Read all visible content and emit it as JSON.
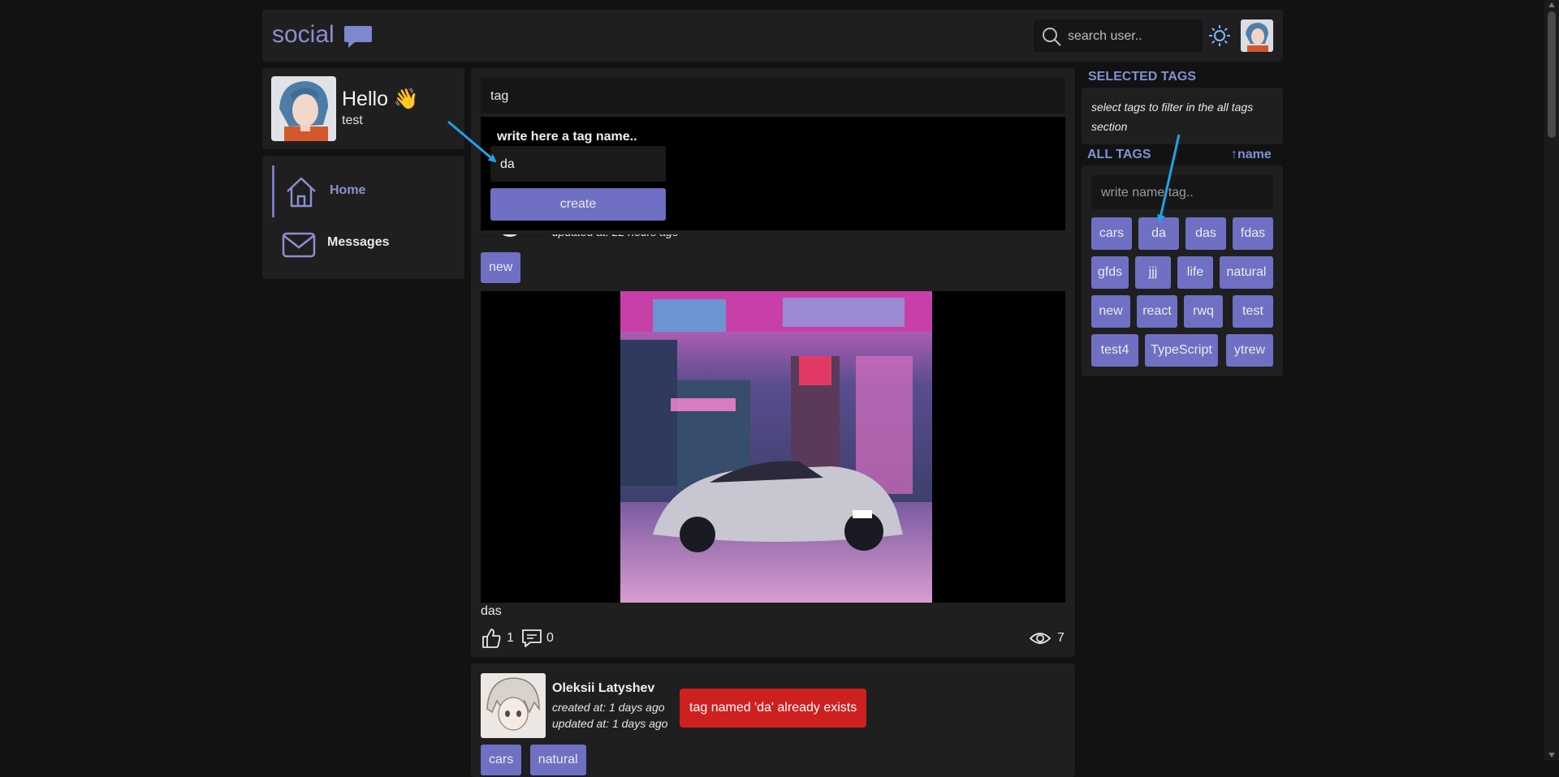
{
  "header": {
    "logo_text": "social",
    "search_placeholder": "search user.."
  },
  "profile": {
    "greeting": "Hello 👋",
    "username": "test"
  },
  "nav": {
    "items": [
      {
        "label": "Home",
        "icon": "home-icon",
        "active": true
      },
      {
        "label": "Messages",
        "icon": "mail-icon",
        "active": false
      }
    ]
  },
  "create_tag": {
    "input_value": "tag",
    "popup_title": "write here a tag name..",
    "popup_input_value": "da",
    "create_label": "create"
  },
  "post1": {
    "updated": "updated at: 22 hours ago",
    "tag": "new",
    "text": "das",
    "likes": "1",
    "comments": "0",
    "views": "7"
  },
  "post2": {
    "author": "Oleksii Latyshev",
    "created": "created at: 1 days ago",
    "updated": "updated at: 1 days ago",
    "tags": [
      "cars",
      "natural"
    ]
  },
  "toast": {
    "message": "tag named 'da' already exists"
  },
  "sidebar": {
    "selected_title": "SELECTED TAGS",
    "selected_hint": "select tags to filter in the all tags section",
    "all_title": "ALL TAGS",
    "sort_label": "↑name",
    "filter_placeholder": "write name tag..",
    "tags": [
      "cars",
      "da",
      "das",
      "fdas",
      "gfds",
      "jjj",
      "life",
      "natural",
      "new",
      "react",
      "rwq",
      "test",
      "test4",
      "TypeScript",
      "ytrew"
    ]
  },
  "colors": {
    "accent": "#6f6fc3",
    "link": "#7f92d6",
    "error": "#cf2020",
    "background": "#121212",
    "card": "#1f1f1f"
  }
}
